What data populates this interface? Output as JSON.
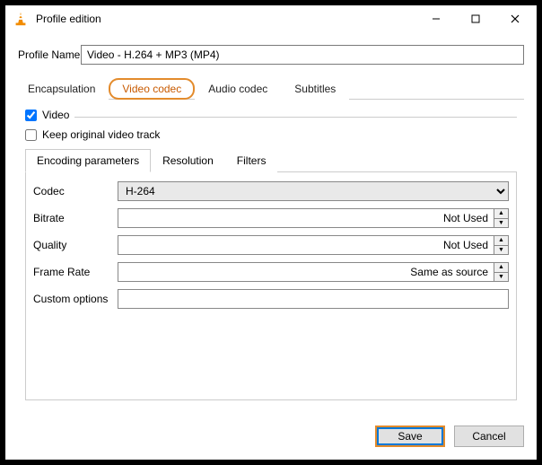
{
  "window": {
    "title": "Profile edition"
  },
  "profile": {
    "label": "Profile Name",
    "value": "Video - H.264 + MP3 (MP4)"
  },
  "tabs": {
    "encapsulation": "Encapsulation",
    "video_codec": "Video codec",
    "audio_codec": "Audio codec",
    "subtitles": "Subtitles"
  },
  "video_group": {
    "video_chk": "Video",
    "keep_original": "Keep original video track"
  },
  "subtabs": {
    "encoding": "Encoding parameters",
    "resolution": "Resolution",
    "filters": "Filters"
  },
  "fields": {
    "codec_label": "Codec",
    "codec_value": "H-264",
    "bitrate_label": "Bitrate",
    "bitrate_value": "Not Used",
    "quality_label": "Quality",
    "quality_value": "Not Used",
    "framerate_label": "Frame Rate",
    "framerate_value": "Same as source",
    "custom_label": "Custom options",
    "custom_value": ""
  },
  "buttons": {
    "save": "Save",
    "cancel": "Cancel"
  }
}
